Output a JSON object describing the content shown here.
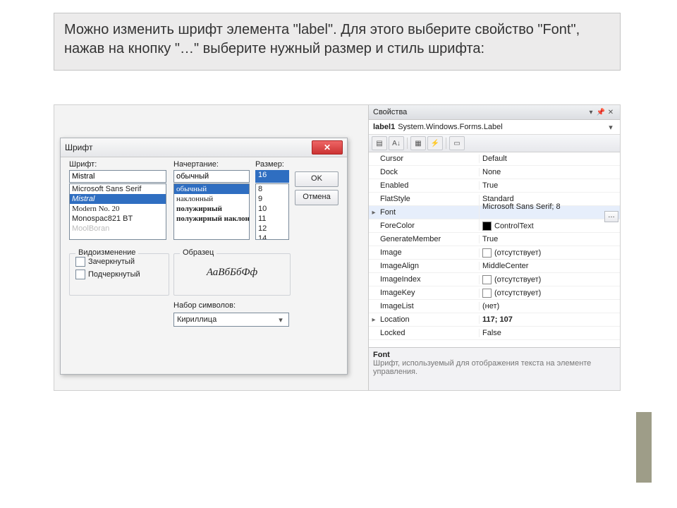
{
  "caption": "Можно изменить шрифт элемента \"label\". Для этого выберите свойство \"Font\", нажав на кнопку \"…\" выберите нужный размер и стиль шрифта:",
  "fontDialog": {
    "title": "Шрифт",
    "labels": {
      "font": "Шрифт:",
      "style": "Начертание:",
      "size": "Размер:"
    },
    "fontInput": "Mistral",
    "styleInput": "обычный",
    "sizeInput": "16",
    "fontList": [
      "Microsoft Sans Serif",
      "Mistral",
      "Modern No. 20",
      "Monospac821 BT",
      "MoolBoran"
    ],
    "styleList": [
      "обычный",
      "наклонный",
      "полужирный",
      "полужирный наклонный"
    ],
    "sizeList": [
      "8",
      "9",
      "10",
      "11",
      "12",
      "14",
      "16"
    ],
    "buttons": {
      "ok": "OK",
      "cancel": "Отмена"
    },
    "effects": {
      "legend": "Видоизменение",
      "strike": "Зачеркнутый",
      "underline": "Подчеркнутый"
    },
    "sample": {
      "legend": "Образец",
      "text": "АаВбБбФф"
    },
    "charsetLabel": "Набор символов:",
    "charsetValue": "Кириллица"
  },
  "props": {
    "title": "Свойства",
    "object": {
      "name": "label1",
      "type": "System.Windows.Forms.Label"
    },
    "rows": [
      {
        "exp": "",
        "name": "Cursor",
        "val": "Default"
      },
      {
        "exp": "",
        "name": "Dock",
        "val": "None"
      },
      {
        "exp": "",
        "name": "Enabled",
        "val": "True"
      },
      {
        "exp": "",
        "name": "FlatStyle",
        "val": "Standard"
      },
      {
        "exp": "▸",
        "name": "Font",
        "val": "Microsoft Sans Serif; 8",
        "sel": true,
        "ell": true
      },
      {
        "exp": "",
        "name": "ForeColor",
        "val": "ControlText",
        "swatch": "black"
      },
      {
        "exp": "",
        "name": "GenerateMember",
        "val": "True"
      },
      {
        "exp": "",
        "name": "Image",
        "val": "(отсутствует)",
        "swatch": "empty"
      },
      {
        "exp": "",
        "name": "ImageAlign",
        "val": "MiddleCenter"
      },
      {
        "exp": "",
        "name": "ImageIndex",
        "val": "(отсутствует)",
        "swatch": "empty"
      },
      {
        "exp": "",
        "name": "ImageKey",
        "val": "(отсутствует)",
        "swatch": "empty"
      },
      {
        "exp": "",
        "name": "ImageList",
        "val": "(нет)"
      },
      {
        "exp": "▸",
        "name": "Location",
        "val": "117; 107",
        "bold": true
      },
      {
        "exp": "",
        "name": "Locked",
        "val": "False"
      }
    ],
    "desc": {
      "title": "Font",
      "text": "Шрифт, используемый для отображения текста на элементе управления."
    }
  }
}
